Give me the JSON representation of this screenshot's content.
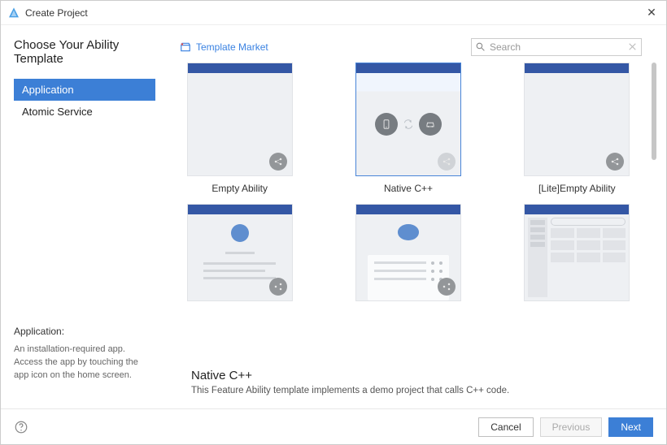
{
  "window": {
    "title": "Create Project"
  },
  "heading": "Choose Your Ability Template",
  "sidebar": {
    "items": [
      {
        "label": "Application",
        "active": true
      },
      {
        "label": "Atomic Service",
        "active": false
      }
    ],
    "desc_title": "Application:",
    "desc_body": "An installation-required app. Access the app by touching the app icon on the home screen."
  },
  "market_link": "Template Market",
  "search": {
    "placeholder": "Search",
    "value": ""
  },
  "templates": [
    {
      "label": "Empty Ability"
    },
    {
      "label": "Native C++",
      "selected": true
    },
    {
      "label": "[Lite]Empty Ability"
    },
    {
      "label": ""
    },
    {
      "label": ""
    },
    {
      "label": ""
    }
  ],
  "detail": {
    "name": "Native C++",
    "desc": "This Feature Ability template implements a demo project that calls C++ code."
  },
  "footer": {
    "cancel": "Cancel",
    "previous": "Previous",
    "next": "Next"
  }
}
